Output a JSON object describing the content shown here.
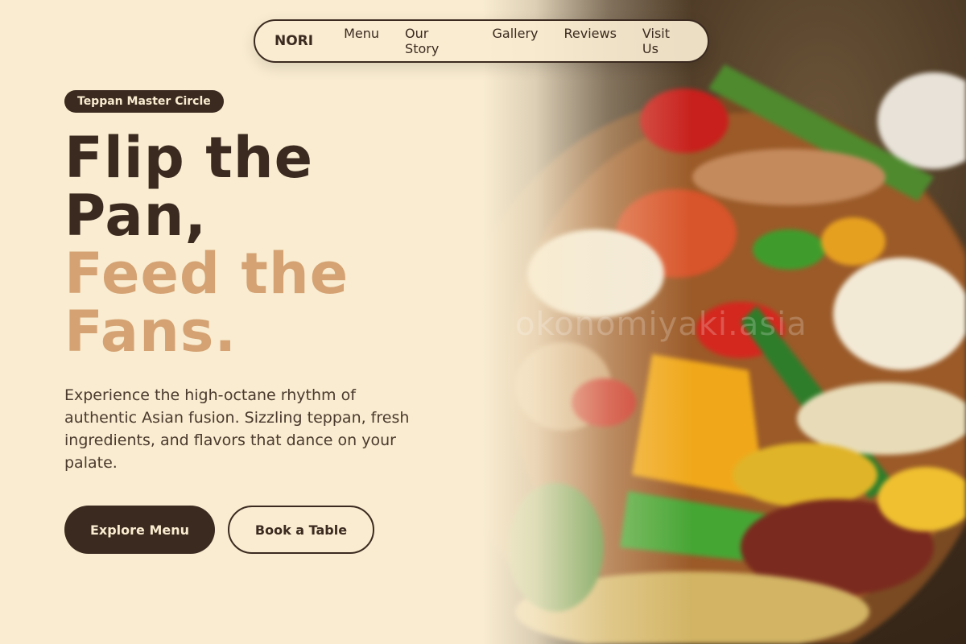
{
  "nav": {
    "brand": "NORI",
    "links": [
      "Menu",
      "Our Story",
      "Gallery",
      "Reviews",
      "Visit Us"
    ]
  },
  "hero": {
    "badge": "Teppan Master Circle",
    "headline_line1": "Flip the",
    "headline_line2": "Pan,",
    "headline_line3": "Feed the",
    "headline_line4": "Fans.",
    "description": "Experience the high-octane rhythm of authentic Asian fusion. Sizzling teppan, fresh ingredients, and flavors that dance on your palate.",
    "primary_button": "Explore Menu",
    "secondary_button": "Book a Table",
    "image_watermark": "okonomiyaki.asia"
  },
  "colors": {
    "background": "#f9ecd0",
    "text_dark": "#3b2a20",
    "accent": "#d4a273"
  }
}
